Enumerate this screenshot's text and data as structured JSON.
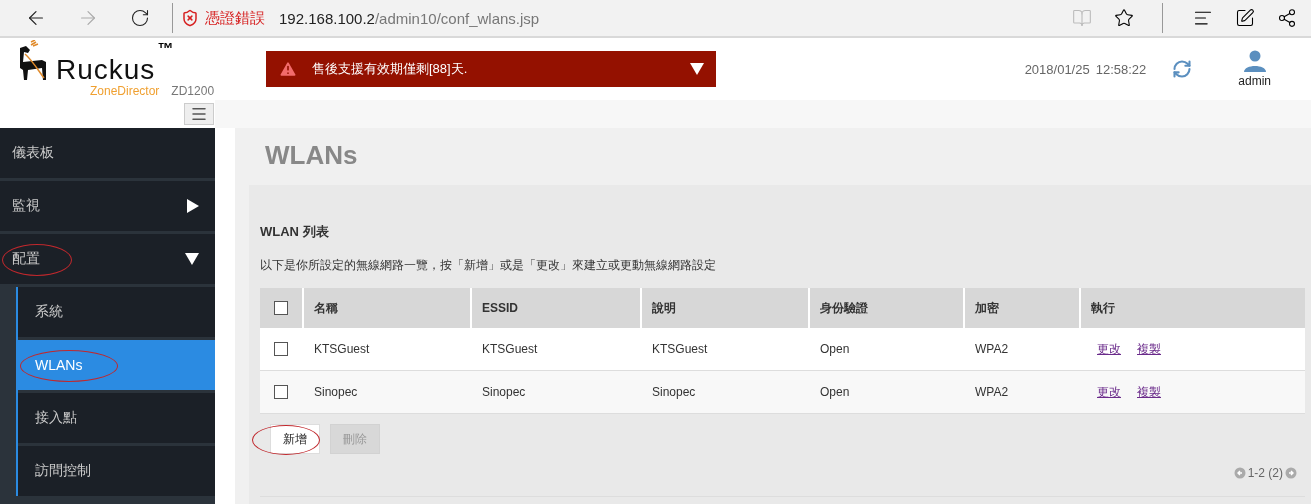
{
  "browser": {
    "security_label": "憑證錯誤",
    "url_host": "192.168.100.2",
    "url_path": "/admin10/conf_wlans.jsp"
  },
  "header": {
    "brand": "Ruckus",
    "trademark": "™",
    "product": "ZoneDirector",
    "model": "ZD1200",
    "alert": "售後支援有效期僅剩[88]天.",
    "date": "2018/01/25",
    "time": "12:58:22",
    "user": "admin"
  },
  "sidebar": {
    "items": [
      {
        "label": "儀表板",
        "kind": "link",
        "selected": false,
        "circled": false
      },
      {
        "label": "監視",
        "kind": "group",
        "expanded": false,
        "selected": false,
        "circled": false
      },
      {
        "label": "配置",
        "kind": "group",
        "expanded": true,
        "selected": false,
        "circled": true,
        "children": [
          {
            "label": "系統",
            "selected": false,
            "circled": false
          },
          {
            "label": "WLANs",
            "selected": true,
            "circled": true
          },
          {
            "label": "接入點",
            "selected": false,
            "circled": false
          },
          {
            "label": "訪問控制",
            "selected": false,
            "circled": false
          }
        ]
      }
    ]
  },
  "page": {
    "title": "WLANs",
    "section_title": "WLAN 列表",
    "description": "以下是你所設定的無線網路一覽，按「新增」或是「更改」來建立或更動無線網路設定"
  },
  "table": {
    "header_checked": false,
    "columns": [
      "名稱",
      "ESSID",
      "說明",
      "身份驗證",
      "加密",
      "執行"
    ],
    "rows": [
      {
        "checked": false,
        "cells": [
          "KTSGuest",
          "KTSGuest",
          "KTSGuest",
          "Open",
          "WPA2"
        ],
        "actions": [
          "更改",
          "複製"
        ]
      },
      {
        "checked": false,
        "cells": [
          "Sinopec",
          "Sinopec",
          "Sinopec",
          "Open",
          "WPA2"
        ],
        "actions": [
          "更改",
          "複製"
        ]
      }
    ]
  },
  "buttons": [
    {
      "label": "新增",
      "disabled": false,
      "circled": true
    },
    {
      "label": "刪除",
      "disabled": true,
      "circled": false
    }
  ],
  "pagination": "1-2 (2)"
}
